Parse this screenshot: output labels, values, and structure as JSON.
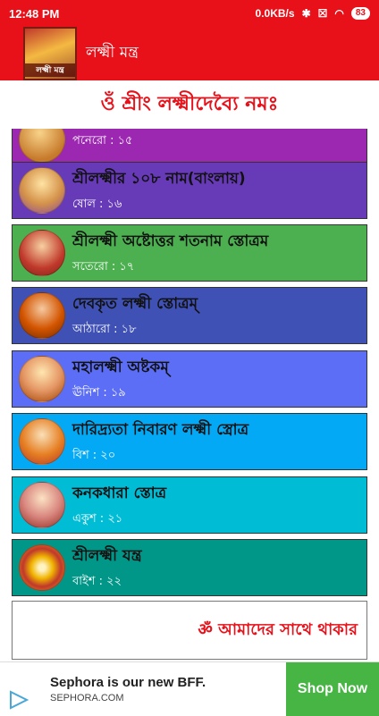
{
  "status_bar": {
    "time": "12:48 PM",
    "network_speed": "0.0KB/s",
    "battery": "83"
  },
  "app_bar": {
    "logo_text": "লক্ষ্মী মন্ত্র",
    "title": "লক্ষ্মী মন্ত্র"
  },
  "heading": "ওঁ শ্রীং লক্ষ্মীদেব্যৈ নমঃ",
  "items": [
    {
      "title": "",
      "sub": "পনেরো : ১৫",
      "color": "#9c27b0"
    },
    {
      "title": "শ্রীলক্ষ্মীর ১০৮ নাম(বাংলায়)",
      "sub": "ষোল : ১৬",
      "color": "#673ab7"
    },
    {
      "title": "শ্রীলক্ষ্মী অষ্টোত্তর শতনাম স্তোত্রম",
      "sub": "সতেরো : ১৭",
      "color": "#4caf50"
    },
    {
      "title": "দেবকৃত লক্ষ্মী স্তোত্রম্",
      "sub": "আঠারো : ১৮",
      "color": "#3f51b5"
    },
    {
      "title": "মহালক্ষ্মী অষ্টকম্",
      "sub": "ঊনিশ : ১৯",
      "color": "#5b6ef5"
    },
    {
      "title": "দারিদ্র্যতা নিবারণ লক্ষ্মী স্ত্রোত্র",
      "sub": "বিশ : ২০",
      "color": "#03a9f4"
    },
    {
      "title": "কনকধারা স্তোত্র",
      "sub": "একুশ : ২১",
      "color": "#00bcd4"
    },
    {
      "title": "শ্রীলক্ষ্মী যন্ত্র",
      "sub": "বাইশ : ২২",
      "color": "#009688"
    }
  ],
  "footer_text": "ॐ আমাদের সাথে থাকার",
  "ad": {
    "title": "Sephora is our new BFF.",
    "url": "SEPHORA.COM",
    "button": "Shop Now"
  }
}
